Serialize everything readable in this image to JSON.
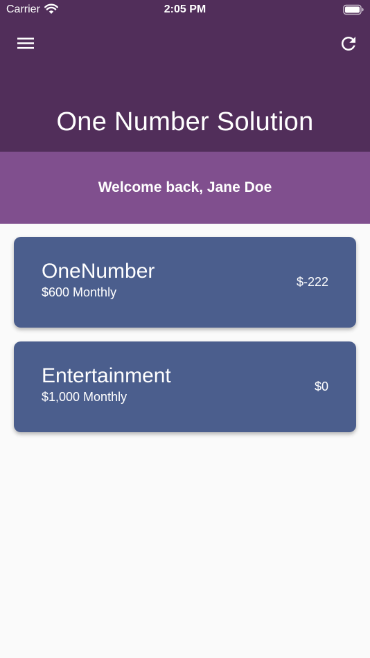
{
  "status_bar": {
    "carrier": "Carrier",
    "time": "2:05 PM",
    "wifi_icon": "wifi-icon",
    "battery_icon": "battery-icon"
  },
  "app_bar": {
    "title": "One Number Solution",
    "menu_icon": "hamburger-menu-icon",
    "refresh_icon": "refresh-icon",
    "background_color": "#512e5a"
  },
  "welcome": {
    "text": "Welcome back, Jane Doe",
    "background_color": "#804f8e"
  },
  "budgets": [
    {
      "name": "OneNumber",
      "monthly": "$600 Monthly",
      "amount": "$-222"
    },
    {
      "name": "Entertainment",
      "monthly": "$1,000 Monthly",
      "amount": "$0"
    }
  ],
  "colors": {
    "card": "#4b5e8d",
    "page_background": "#fafafa"
  }
}
